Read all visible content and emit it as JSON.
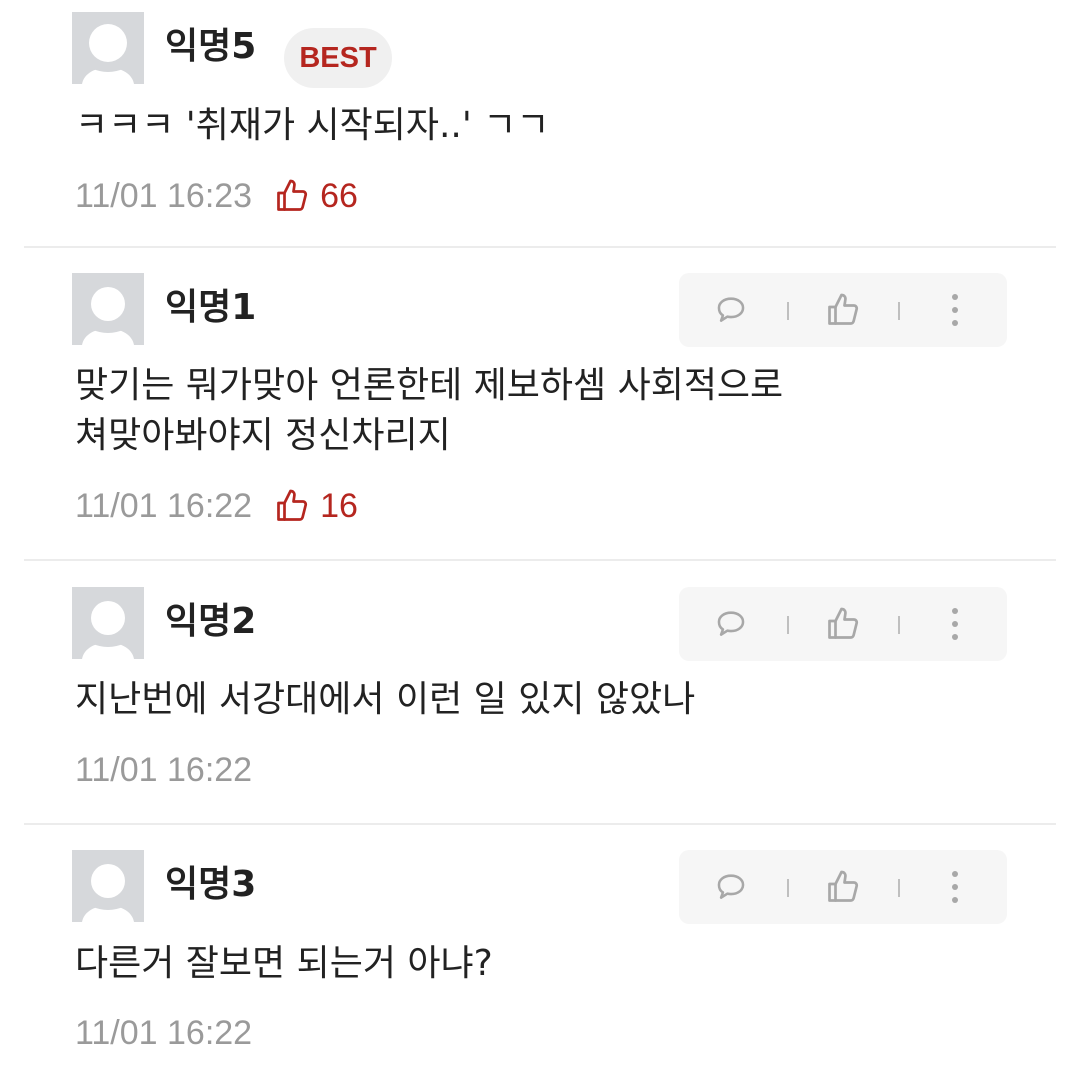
{
  "colors": {
    "accent_red": "#b5261f",
    "text_primary": "#222222",
    "text_meta": "#9a9a9a",
    "badge_bg": "#f0f0f0",
    "action_bar_bg": "#f6f6f6",
    "avatar_bg": "#d6d8db"
  },
  "icons": {
    "avatar": "default-avatar-icon",
    "like": "thumbs-up-icon",
    "reply": "speech-bubble-icon",
    "more": "vertical-dots-icon"
  },
  "comments": [
    {
      "author": "익명5",
      "badge": "BEST",
      "body_lines": [
        "ㅋㅋㅋ '취재가 시작되자..' ㄱㄱ"
      ],
      "timestamp": "11/01 16:23",
      "likes": "66"
    },
    {
      "author": "익명1",
      "body_lines": [
        "맞기는 뭐가맞아 언론한테 제보하셈 사회적으로",
        "쳐맞아봐야지 정신차리지"
      ],
      "timestamp": "11/01 16:22",
      "likes": "16"
    },
    {
      "author": "익명2",
      "body_lines": [
        "지난번에 서강대에서 이런 일 있지 않았나"
      ],
      "timestamp": "11/01 16:22"
    },
    {
      "author": "익명3",
      "body_lines": [
        "다른거 잘보면 되는거 아냐?"
      ],
      "timestamp": "11/01 16:22"
    }
  ]
}
